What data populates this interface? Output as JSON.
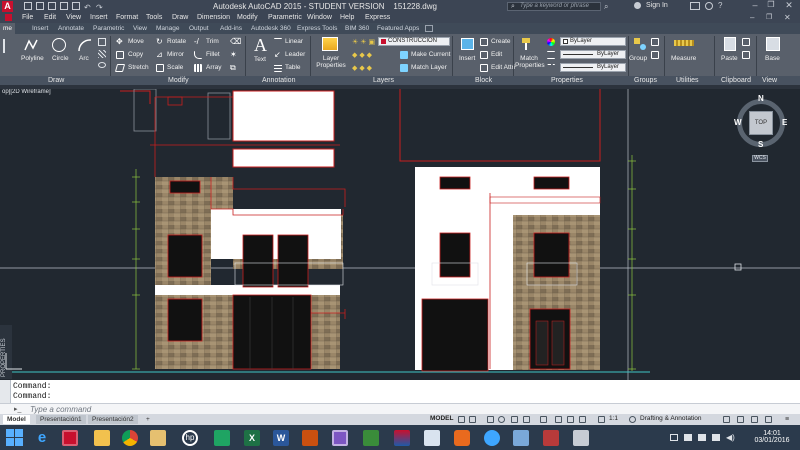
{
  "titlebar": {
    "app_logo": "A",
    "title": "Autodesk AutoCAD 2015 - STUDENT VERSION",
    "filename": "151228.dwg",
    "search_placeholder": "Type a keyword or phrase",
    "sign_in": "Sign In"
  },
  "menubar": [
    "File",
    "Edit",
    "View",
    "Insert",
    "Format",
    "Tools",
    "Draw",
    "Dimension",
    "Modify",
    "Parametric",
    "Window",
    "Help",
    "Express"
  ],
  "ribbon_tabs": [
    "me",
    "Insert",
    "Annotate",
    "Parametric",
    "View",
    "Manage",
    "Output",
    "Add-ins",
    "Autodesk 360",
    "Express Tools",
    "BIM 360",
    "Featured Apps"
  ],
  "ribbon": {
    "draw": {
      "polyline": "Polyline",
      "circle": "Circle",
      "arc": "Arc"
    },
    "modify": {
      "move": "Move",
      "rotate": "Rotate",
      "trim": "Trim",
      "copy": "Copy",
      "mirror": "Mirror",
      "fillet": "Fillet",
      "stretch": "Stretch",
      "scale": "Scale",
      "array": "Array"
    },
    "annotation": {
      "text": "Text",
      "linear": "Linear",
      "leader": "Leader",
      "table": "Table"
    },
    "layers": {
      "layer_properties": "Layer Properties",
      "current_layer": "CONSTRUCCION",
      "make_current": "Make Current",
      "match_layer": "Match Layer"
    },
    "block": {
      "insert": "Insert",
      "create": "Create",
      "edit": "Edit",
      "edit_attributes": "Edit Attributes"
    },
    "properties": {
      "match_properties": "Match Properties",
      "color": "ByLayer",
      "linetype": "ByLayer",
      "lineweight": "ByLayer"
    },
    "groups": {
      "group": "Group"
    },
    "utilities": {
      "measure": "Measure"
    },
    "clipboard": {
      "paste": "Paste"
    },
    "view": {
      "base": "Base"
    }
  },
  "panel_titles": [
    "Draw",
    "Modify",
    "Annotation",
    "Layers",
    "Block",
    "Properties",
    "Groups",
    "Utilities",
    "Clipboard",
    "View"
  ],
  "viewport": {
    "label": "op][2D Wireframe]",
    "viewcube": {
      "n": "N",
      "s": "S",
      "e": "E",
      "w": "W",
      "top": "TOP",
      "wcs": "WCS"
    },
    "properties_palette": "PROPERTIES"
  },
  "command": {
    "history": [
      "Command:",
      "Command:"
    ],
    "placeholder": "Type a command"
  },
  "status": {
    "tabs": [
      "Model",
      "Presentación1",
      "Presentación2"
    ],
    "model": "MODEL",
    "scale": "1:1",
    "workspace": "Drafting & Annotation"
  },
  "taskbar": {
    "time": "14:01",
    "date": "03/01/2016"
  },
  "colors": {
    "accent_red": "#c81e1e",
    "drawing_bg": "#212830",
    "dimension_green": "#8ec63f"
  }
}
